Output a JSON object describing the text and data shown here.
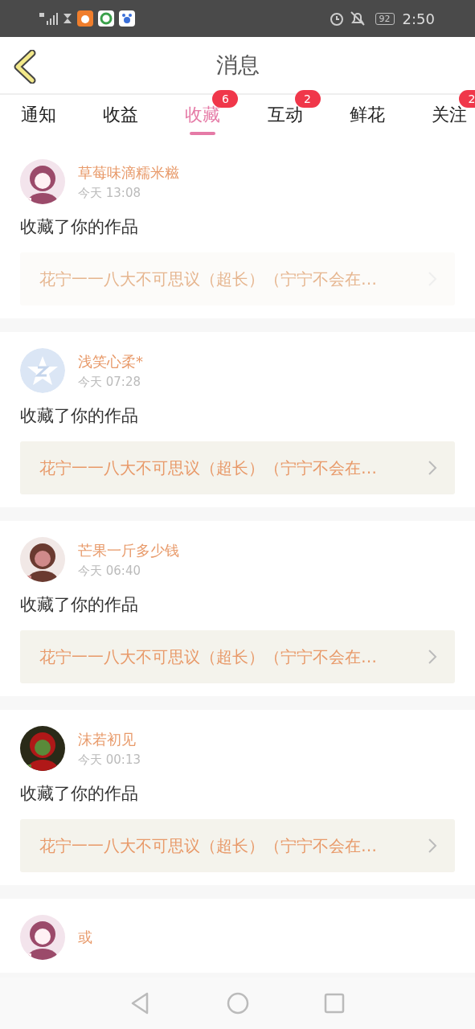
{
  "status_bar": {
    "battery": "92",
    "time": "2:50"
  },
  "header": {
    "title": "消息"
  },
  "tabs": [
    {
      "label": "通知",
      "selected": false
    },
    {
      "label": "收益",
      "selected": false
    },
    {
      "label": "收藏",
      "selected": true,
      "badge": "6"
    },
    {
      "label": "互动",
      "selected": false,
      "badge": "2"
    },
    {
      "label": "鲜花",
      "selected": false
    },
    {
      "label": "关注",
      "selected": false,
      "badge": "2"
    }
  ],
  "messages": [
    {
      "name": "草莓味滴糯米糍",
      "time": "今天 13:08",
      "text": "收藏了你的作品",
      "work": {
        "title": "花宁一一八大不可思议（超长）（宁宁不会在…",
        "dimmed": true
      }
    },
    {
      "avatar": {
        "kind": "default"
      },
      "name": "浅笑心柔*",
      "time": "今天 07:28",
      "text": "收藏了你的作品",
      "work": {
        "title": "花宁一一八大不可思议（超长）（宁宁不会在…",
        "dimmed": false
      }
    },
    {
      "name": "芒果一斤多少钱",
      "time": "今天 06:40",
      "text": "收藏了你的作品",
      "work": {
        "title": "花宁一一八大不可思议（超长）（宁宁不会在…",
        "dimmed": false
      }
    },
    {
      "name": "沫若初见",
      "time": "今天 00:13",
      "text": "收藏了你的作品",
      "work": {
        "title": "花宁一一八大不可思议（超长）（宁宁不会在…",
        "dimmed": false
      }
    },
    {
      "name": "或"
    }
  ]
}
